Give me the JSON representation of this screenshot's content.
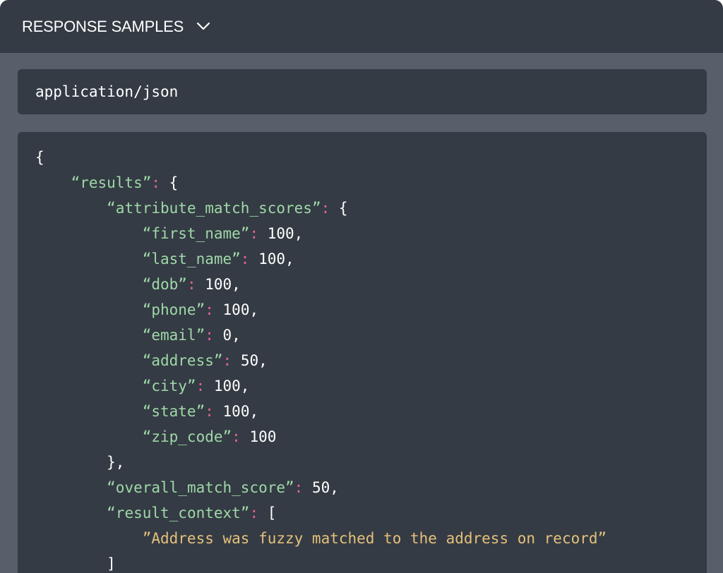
{
  "header": {
    "title": "RESPONSE SAMPLES",
    "chevron_icon": "chevron-down-icon"
  },
  "content_type": {
    "value": "application/json"
  },
  "code": {
    "lines": [
      {
        "indent": 0,
        "parts": [
          {
            "c": "n",
            "t": "{"
          }
        ]
      },
      {
        "indent": 1,
        "parts": [
          {
            "c": "k",
            "t": "“results”"
          },
          {
            "c": "p",
            "t": ":"
          },
          {
            "c": "n",
            "t": " {"
          }
        ]
      },
      {
        "indent": 2,
        "parts": [
          {
            "c": "k",
            "t": "“attribute_match_scores”"
          },
          {
            "c": "p",
            "t": ":"
          },
          {
            "c": "n",
            "t": " {"
          }
        ]
      },
      {
        "indent": 3,
        "parts": [
          {
            "c": "k",
            "t": "“first_name”"
          },
          {
            "c": "p",
            "t": ":"
          },
          {
            "c": "n",
            "t": " 100,"
          }
        ]
      },
      {
        "indent": 3,
        "parts": [
          {
            "c": "k",
            "t": "“last_name”"
          },
          {
            "c": "p",
            "t": ":"
          },
          {
            "c": "n",
            "t": " 100,"
          }
        ]
      },
      {
        "indent": 3,
        "parts": [
          {
            "c": "k",
            "t": "“dob”"
          },
          {
            "c": "p",
            "t": ":"
          },
          {
            "c": "n",
            "t": " 100,"
          }
        ]
      },
      {
        "indent": 3,
        "parts": [
          {
            "c": "k",
            "t": "“phone”"
          },
          {
            "c": "p",
            "t": ":"
          },
          {
            "c": "n",
            "t": " 100,"
          }
        ]
      },
      {
        "indent": 3,
        "parts": [
          {
            "c": "k",
            "t": "“email”"
          },
          {
            "c": "p",
            "t": ":"
          },
          {
            "c": "n",
            "t": " 0,"
          }
        ]
      },
      {
        "indent": 3,
        "parts": [
          {
            "c": "k",
            "t": "“address”"
          },
          {
            "c": "p",
            "t": ":"
          },
          {
            "c": "n",
            "t": " 50,"
          }
        ]
      },
      {
        "indent": 3,
        "parts": [
          {
            "c": "k",
            "t": "“city”"
          },
          {
            "c": "p",
            "t": ":"
          },
          {
            "c": "n",
            "t": " 100,"
          }
        ]
      },
      {
        "indent": 3,
        "parts": [
          {
            "c": "k",
            "t": "“state”"
          },
          {
            "c": "p",
            "t": ":"
          },
          {
            "c": "n",
            "t": " 100,"
          }
        ]
      },
      {
        "indent": 3,
        "parts": [
          {
            "c": "k",
            "t": "“zip_code”"
          },
          {
            "c": "p",
            "t": ":"
          },
          {
            "c": "n",
            "t": " 100"
          }
        ]
      },
      {
        "indent": 2,
        "parts": [
          {
            "c": "n",
            "t": "},"
          }
        ]
      },
      {
        "indent": 2,
        "parts": [
          {
            "c": "k",
            "t": "“overall_match_score”"
          },
          {
            "c": "p",
            "t": ":"
          },
          {
            "c": "n",
            "t": " 50,"
          }
        ]
      },
      {
        "indent": 2,
        "parts": [
          {
            "c": "k",
            "t": "“result_context”"
          },
          {
            "c": "p",
            "t": ":"
          },
          {
            "c": "n",
            "t": " ["
          }
        ]
      },
      {
        "indent": 3,
        "parts": [
          {
            "c": "s",
            "t": "”Address was fuzzy matched to the address on record”"
          }
        ]
      },
      {
        "indent": 2,
        "parts": [
          {
            "c": "n",
            "t": "]"
          }
        ]
      }
    ]
  }
}
